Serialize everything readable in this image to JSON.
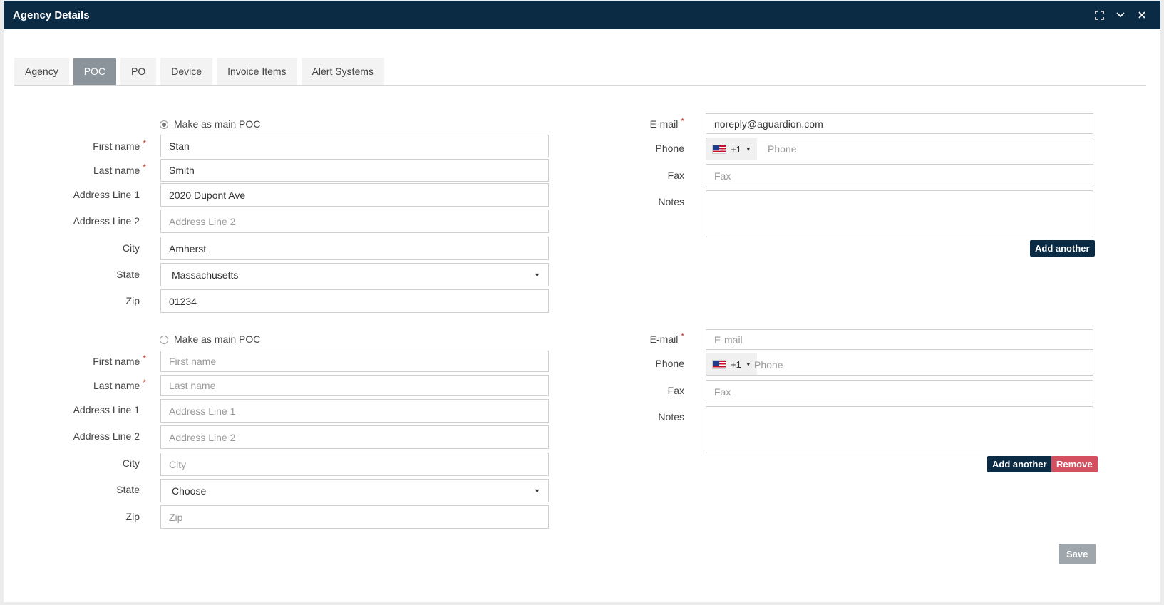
{
  "window": {
    "title": "Agency Details"
  },
  "titlebar_icons": [
    "maximize-icon",
    "chevron-down-icon",
    "close-icon"
  ],
  "tabs": [
    {
      "label": "Agency",
      "active": false
    },
    {
      "label": "POC",
      "active": true
    },
    {
      "label": "PO",
      "active": false
    },
    {
      "label": "Device",
      "active": false
    },
    {
      "label": "Invoice Items",
      "active": false
    },
    {
      "label": "Alert Systems",
      "active": false
    }
  ],
  "labels": {
    "make_main": "Make as main POC",
    "first_name": "First name",
    "last_name": "Last name",
    "address1": "Address Line 1",
    "address2": "Address Line 2",
    "city": "City",
    "state": "State",
    "zip": "Zip",
    "email": "E-mail",
    "phone": "Phone",
    "fax": "Fax",
    "notes": "Notes",
    "required_mark": "*"
  },
  "poc1": {
    "main_selected": true,
    "first_name": "Stan",
    "last_name": "Smith",
    "address1": "2020 Dupont Ave",
    "address2_placeholder": "Address Line 2",
    "city": "Amherst",
    "state": "Massachusetts",
    "zip": "01234",
    "email": "noreply@aguardion.com",
    "phone_prefix": "+1",
    "phone_placeholder": "Phone",
    "fax_placeholder": "Fax",
    "notes": ""
  },
  "poc2": {
    "main_selected": false,
    "first_name_placeholder": "First name",
    "last_name_placeholder": "Last name",
    "address1_placeholder": "Address Line 1",
    "address2_placeholder": "Address Line 2",
    "city_placeholder": "City",
    "state": "Choose",
    "zip_placeholder": "Zip",
    "email_placeholder": "E-mail",
    "phone_prefix": "+1",
    "phone_placeholder": "Phone",
    "fax_placeholder": "Fax",
    "notes": ""
  },
  "buttons": {
    "add_another": "Add another",
    "remove": "Remove",
    "save": "Save"
  },
  "colors": {
    "titlebar": "#0b2a44",
    "active_tab": "#8c949b",
    "required": "#c0392b",
    "remove": "#d45060",
    "save_disabled": "#a0a7ac"
  }
}
